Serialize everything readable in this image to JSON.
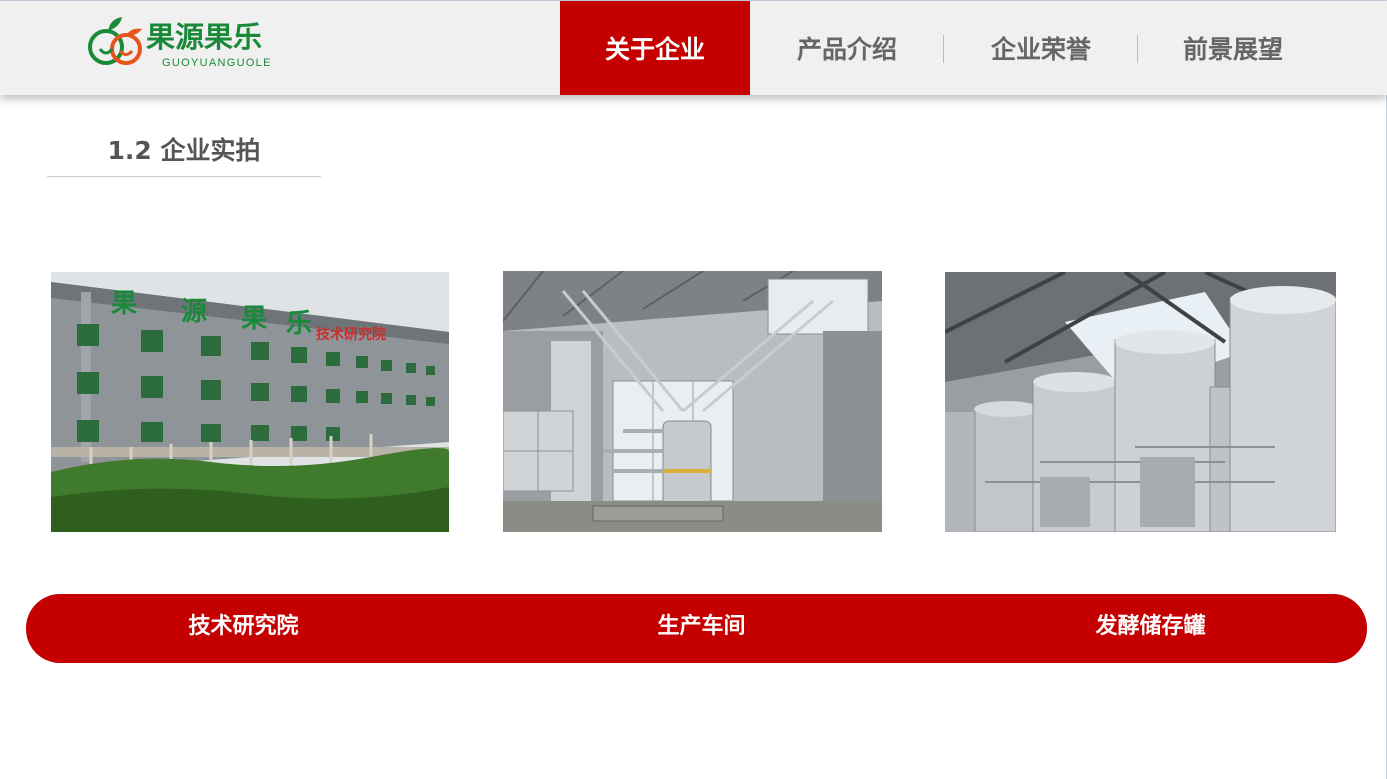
{
  "brand": {
    "name": "果源果乐",
    "subtitle": "GUOYUANGUOLE",
    "color": "#1a8a3a",
    "accent": "#e8541e"
  },
  "nav": {
    "items": [
      {
        "label": "关于企业",
        "active": true
      },
      {
        "label": "产品介绍",
        "active": false
      },
      {
        "label": "企业荣誉",
        "active": false
      },
      {
        "label": "前景展望",
        "active": false
      }
    ],
    "active_color": "#c40000"
  },
  "section": {
    "title": "1.2 企业实拍"
  },
  "photos": [
    {
      "caption": "技术研究院",
      "subject": "office-building"
    },
    {
      "caption": "生产车间",
      "subject": "production-workshop"
    },
    {
      "caption": "发酵储存罐",
      "subject": "fermentation-tanks"
    }
  ],
  "caption_bar_color": "#c40000"
}
